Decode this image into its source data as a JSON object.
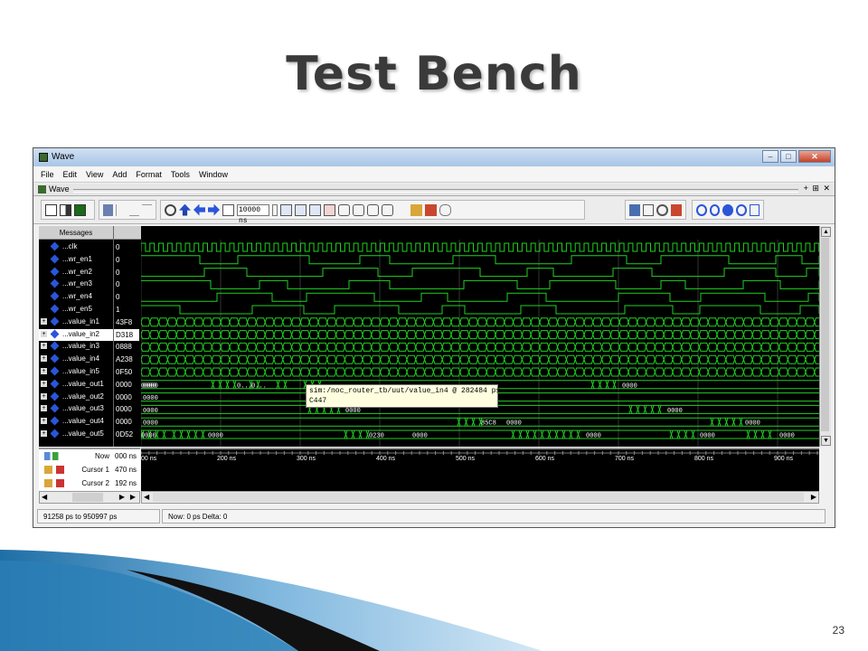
{
  "slide": {
    "title": "Test Bench",
    "number": "23"
  },
  "window": {
    "title": "Wave",
    "controls": {
      "minimize": "–",
      "maximize": "□",
      "close": "✕"
    },
    "menu": [
      "File",
      "Edit",
      "View",
      "Add",
      "Format",
      "Tools",
      "Window"
    ],
    "pane_title": "Wave",
    "pane_controls": "+ ⊞ ✕",
    "time_step": "10000 ns"
  },
  "messages_header": "Messages",
  "signals": [
    {
      "name": "...clk",
      "value": "0",
      "type": "bit"
    },
    {
      "name": "...wr_en1",
      "value": "0",
      "type": "bit"
    },
    {
      "name": "...wr_en2",
      "value": "0",
      "type": "bit"
    },
    {
      "name": "...wr_en3",
      "value": "0",
      "type": "bit"
    },
    {
      "name": "...wr_en4",
      "value": "0",
      "type": "bit"
    },
    {
      "name": "...wr_en5",
      "value": "1",
      "type": "bit"
    },
    {
      "name": "...value_in1",
      "value": "43F8",
      "type": "bus"
    },
    {
      "name": "...value_in2",
      "value": "D318",
      "type": "bus",
      "selected": true
    },
    {
      "name": "...value_in3",
      "value": "0888",
      "type": "bus"
    },
    {
      "name": "...value_in4",
      "value": "A238",
      "type": "bus"
    },
    {
      "name": "...value_in5",
      "value": "0F50",
      "type": "bus"
    },
    {
      "name": "...value_out1",
      "value": "0000",
      "type": "bus"
    },
    {
      "name": "...value_out2",
      "value": "0000",
      "type": "bus"
    },
    {
      "name": "...value_out3",
      "value": "0000",
      "type": "bus"
    },
    {
      "name": "...value_out4",
      "value": "0000",
      "type": "bus"
    },
    {
      "name": "...value_out5",
      "value": "0D52",
      "type": "bus"
    }
  ],
  "bus_labels": {
    "out1": [
      "0000",
      "0...",
      "0...",
      "0000",
      "0000"
    ],
    "out2": [
      "0000"
    ],
    "out3": [
      "0000",
      "0000",
      "0000"
    ],
    "out4": [
      "0000",
      "85C8",
      "0000",
      "0000"
    ],
    "out5": [
      "0000",
      "0000",
      "0230",
      "0000",
      "0000",
      "0000",
      "0000"
    ]
  },
  "tooltip": {
    "line1": "sim:/noc_router_tb/uut/value_in4 @ 282484 ps",
    "line2": "C447"
  },
  "time_axis": {
    "label": "Now",
    "now_value": "000 ns",
    "ticks": [
      "00 ns",
      "200 ns",
      "300 ns",
      "400 ns",
      "500 ns",
      "600 ns",
      "700 ns",
      "800 ns",
      "900 ns"
    ]
  },
  "cursors": [
    {
      "label": "Cursor 1",
      "value": "470 ns"
    },
    {
      "label": "Cursor 2",
      "value": "192 ns"
    }
  ],
  "status": {
    "range": "91258 ps to 950997 ps",
    "now": "Now: 0 ps  Delta: 0"
  },
  "colors": {
    "wave_green": "#1fd11f",
    "background": "#000000",
    "tooltip": "#ffffe0"
  }
}
